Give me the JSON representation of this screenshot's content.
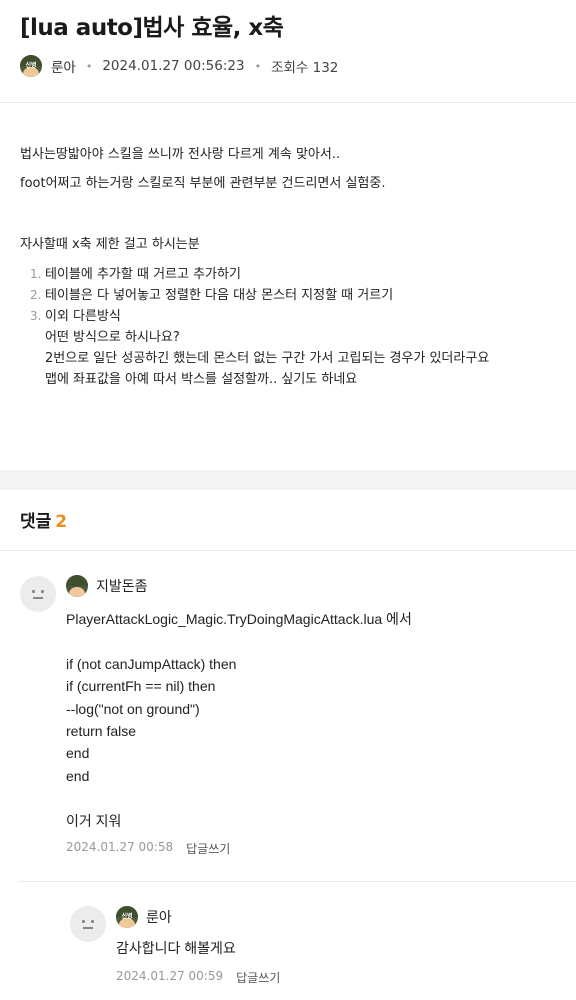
{
  "post": {
    "title": "[lua auto]법사 효율, x축",
    "author": "룬아",
    "badge_text": "신병",
    "datetime": "2024.01.27 00:56:23",
    "views_label": "조회수 132",
    "paragraphs": [
      "법사는땅밟아야 스킬을 쓰니까 전사랑 다르게 계속 맞아서..",
      "foot어쩌고 하는거랑 스킬로직 부분에 관련부분 건드리면서 실험중.",
      "자사할때 x축 제한 걸고 하시는분"
    ],
    "list": [
      {
        "num": "1.",
        "text": "테이블에 추가할 때 거르고 추가하기"
      },
      {
        "num": "2.",
        "text": "테이블은 다 넣어놓고 정렬한 다음 대상 몬스터 지정할 때 거르기"
      },
      {
        "num": "3.",
        "text": "이외 다른방식"
      }
    ],
    "list_sub": [
      "어떤 방식으로 하시나요?",
      "2번으로 일단 성공하긴 했는데 몬스터 없는 구간 가서 고립되는 경우가 있더라구요",
      "맵에 좌표값을 아예 따서 박스를 설정할까.. 싶기도 하네요"
    ]
  },
  "comments": {
    "heading": "댓글",
    "count": "2",
    "items": [
      {
        "author": "지발돈좀",
        "lines": [
          "PlayerAttackLogic_Magic.TryDoingMagicAttack.lua 에서",
          "",
          "if (not canJumpAttack) then",
          "if (currentFh == nil) then",
          "--log(\"not on ground\")",
          "return false",
          "end",
          "end",
          "",
          "이거 지워"
        ],
        "datetime": "2024.01.27 00:58",
        "reply_label": "답글쓰기"
      },
      {
        "author": "룬아",
        "badge_text": "신병",
        "lines": [
          "감사합니다 해볼게요"
        ],
        "datetime": "2024.01.27 00:59",
        "reply_label": "답글쓰기"
      }
    ]
  },
  "colors": {
    "accent_count": "#f08c1a",
    "muted": "#999999",
    "divider": "#ececec"
  }
}
